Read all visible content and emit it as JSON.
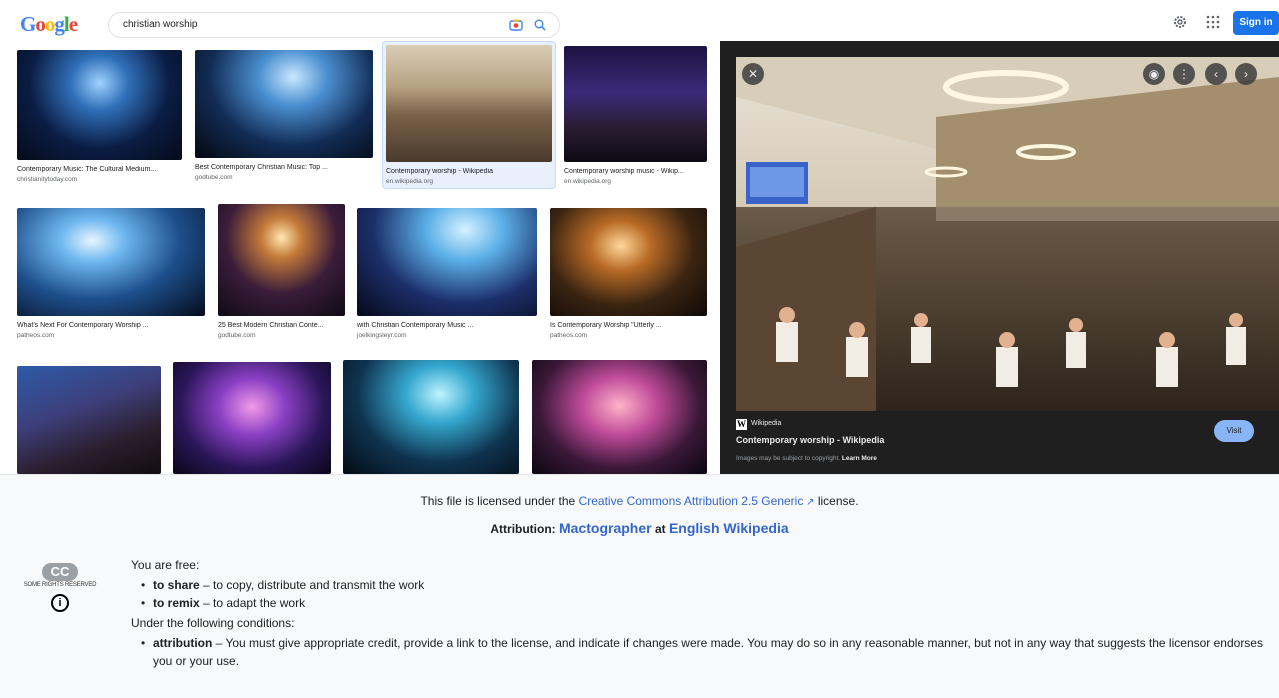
{
  "header": {
    "logo": "Google",
    "search_value": "christian worship",
    "signin_label": "Sign in",
    "icons": [
      "camera-icon",
      "search-icon",
      "settings-icon",
      "apps-icon"
    ]
  },
  "results": [
    {
      "title": "Contemporary Music: The Cultural Medium...",
      "source": "christianitytoday.com"
    },
    {
      "title": "Best Contemporary Christian Music: Top ...",
      "source": "godtube.com"
    },
    {
      "title": "Contemporary worship - Wikipedia",
      "source": "en.wikipedia.org",
      "selected": true
    },
    {
      "title": "Contemporary worship music - Wikip...",
      "source": "en.wikipedia.org"
    },
    {
      "title": "What's Next For Contemporary Worship ...",
      "source": "patheos.com"
    },
    {
      "title": "25 Best Modern Christian Conte...",
      "source": "godtube.com"
    },
    {
      "title": "with Christian Contemporary Music ...",
      "source": "joelkingsleyr.com"
    },
    {
      "title": "Is Contemporary Worship \"Utterly ...",
      "source": "patheos.com"
    },
    {
      "title": "",
      "source": ""
    },
    {
      "title": "",
      "source": ""
    },
    {
      "title": "",
      "source": ""
    },
    {
      "title": "",
      "source": ""
    }
  ],
  "preview": {
    "site_badge": "W",
    "site_name": "Wikipedia",
    "title": "Contemporary worship - Wikipedia",
    "copyright_note": "Images may be subject to copyright.",
    "learn_more": "Learn More",
    "visit_label": "Visit",
    "close_symbol": "✕",
    "prev_symbol": "‹",
    "next_symbol": "›",
    "more_symbol": "⋮",
    "lens_symbol": "◉"
  },
  "license": {
    "line1_prefix": "This file is licensed under the",
    "line1_link": "Creative Commons Attribution 2.5 Generic",
    "line1_suffix": "license.",
    "attribution_label": "Attribution:",
    "attribution_author": "Mactographer",
    "attribution_at": "at",
    "attribution_site": "English Wikipedia",
    "cc_mark": "CC",
    "cc_text": "SOME RIGHTS RESERVED",
    "free_heading": "You are free:",
    "share_term": "to share",
    "share_desc": "– to copy, distribute and transmit the work",
    "remix_term": "to remix",
    "remix_desc": "– to adapt the work",
    "conditions_heading": "Under the following conditions:",
    "attr_term": "attribution",
    "attr_desc": "– You must give appropriate credit, provide a link to the license, and indicate if changes were made. You may do so in any reasonable manner, but not in any way that suggests the licensor endorses you or your use."
  },
  "colors": {
    "accent": "#1a73e8",
    "link": "#3366cc",
    "preview_bg": "#1f1f1f",
    "selected_bg": "#e8f0fe"
  }
}
